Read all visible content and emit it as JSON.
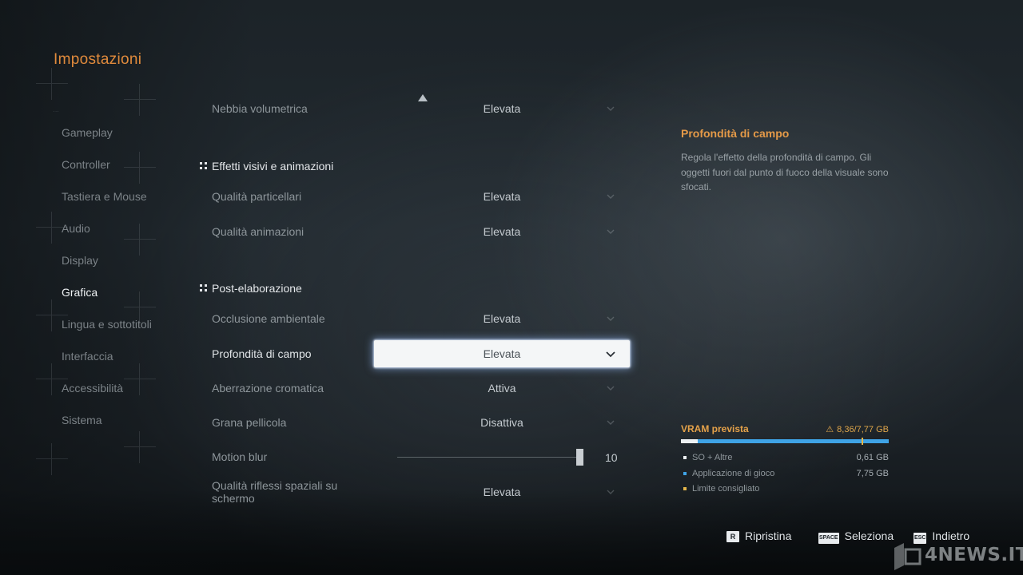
{
  "page_title": "Impostazioni",
  "tiny_text": "...",
  "nav": {
    "items": [
      {
        "label": "Gameplay",
        "active": false
      },
      {
        "label": "Controller",
        "active": false
      },
      {
        "label": "Tastiera e Mouse",
        "active": false
      },
      {
        "label": "Audio",
        "active": false
      },
      {
        "label": "Display",
        "active": false
      },
      {
        "label": "Grafica",
        "active": true
      },
      {
        "label": "Lingua e sottotitoli",
        "active": false
      },
      {
        "label": "Interfaccia",
        "active": false
      },
      {
        "label": "Accessibilità",
        "active": false
      },
      {
        "label": "Sistema",
        "active": false
      }
    ]
  },
  "settings": {
    "nebbia": {
      "label": "Nebbia volumetrica",
      "value": "Elevata"
    },
    "section_effetti": "Effetti visivi e animazioni",
    "particellari": {
      "label": "Qualità particellari",
      "value": "Elevata"
    },
    "animazioni": {
      "label": "Qualità animazioni",
      "value": "Elevata"
    },
    "section_post": "Post-elaborazione",
    "occlusione": {
      "label": "Occlusione ambientale",
      "value": "Elevata"
    },
    "profondita": {
      "label": "Profondità di campo",
      "value": "Elevata"
    },
    "aberrazione": {
      "label": "Aberrazione cromatica",
      "value": "Attiva"
    },
    "grana": {
      "label": "Grana pellicola",
      "value": "Disattiva"
    },
    "motion_blur": {
      "label": "Motion blur",
      "value": "10",
      "fraction": 1.0
    },
    "riflessi": {
      "label": "Qualità riflessi spaziali su schermo",
      "value": "Elevata"
    }
  },
  "info": {
    "title": "Profondità di campo",
    "description": "Regola l'effetto della profondità di campo. Gli oggetti fuori dal punto di fuoco della visuale sono sfocati."
  },
  "vram": {
    "title": "VRAM prevista",
    "usage": "8,36/7,77 GB",
    "os_fraction": 0.08,
    "limit_fraction": 0.87,
    "legend": [
      {
        "label": "SO + Altre",
        "amount": "0,61 GB",
        "color": "#eef1f3"
      },
      {
        "label": "Applicazione di gioco",
        "amount": "7,75 GB",
        "color": "#3fa3e6"
      },
      {
        "label": "Limite consigliato",
        "amount": "",
        "color": "#e5b64a"
      }
    ]
  },
  "footer": {
    "reset": {
      "key": "R",
      "label": "Ripristina"
    },
    "select": {
      "key": "SPACE",
      "label": "Seleziona"
    },
    "back": {
      "key": "ESC",
      "label": "Indietro"
    }
  },
  "watermark": "4NEWS.IT",
  "colors": {
    "accent": "#e08a3c",
    "vram_blue": "#3fa3e6",
    "focus_glow": "#8cafe6"
  }
}
